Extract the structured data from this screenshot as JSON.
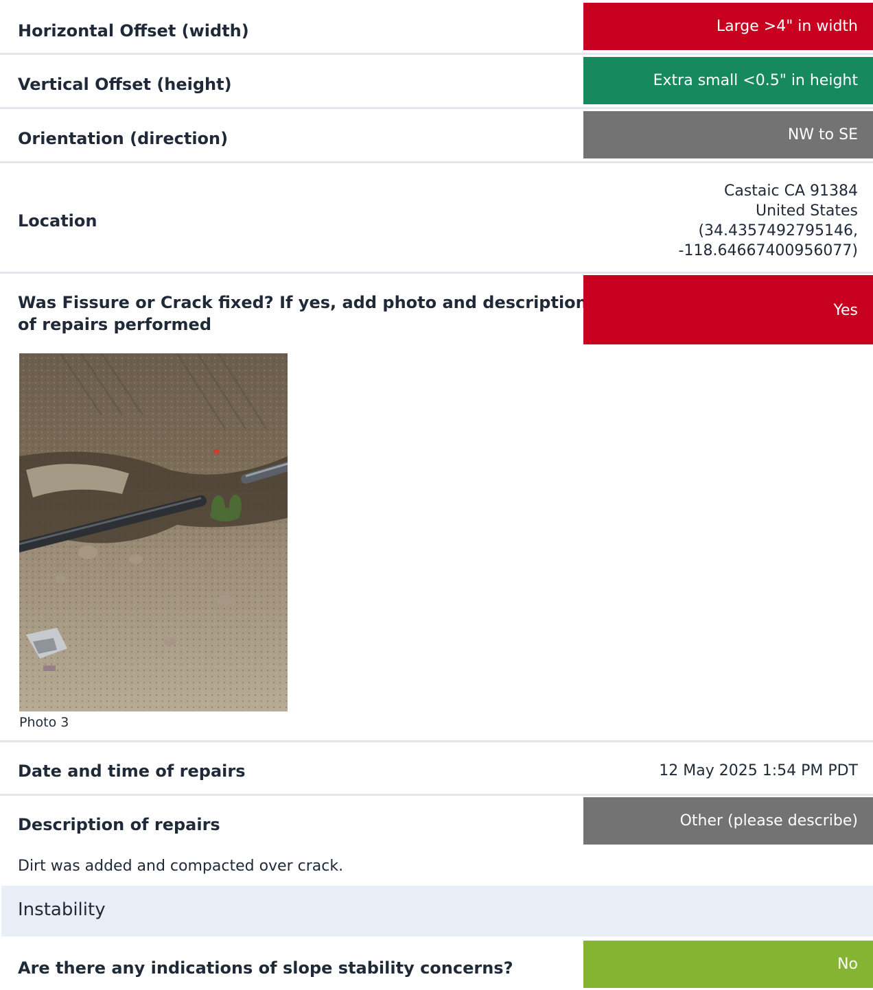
{
  "rows": {
    "horizontal_offset": {
      "label": "Horizontal Offset (width)",
      "value": "Large >4\" in width",
      "color": "#c8001f"
    },
    "vertical_offset": {
      "label": "Vertical Offset (height)",
      "value": "Extra small <0.5\" in height",
      "color": "#168a5e"
    },
    "orientation": {
      "label": "Orientation (direction)",
      "value": "NW to SE",
      "color": "#737373"
    },
    "location": {
      "label": "Location",
      "lines": [
        "Castaic CA 91384",
        "United States",
        "(34.4357492795146,",
        "-118.64667400956077)"
      ]
    },
    "fixed": {
      "label_line1": "Was Fissure or Crack fixed? If yes, add photo and description",
      "label_line2": "of repairs performed",
      "value": "Yes",
      "color": "#c8001f"
    },
    "photo": {
      "caption": "Photo 3"
    },
    "repair_date": {
      "label": "Date and time of repairs",
      "value": "12 May 2025 1:54 PM PDT"
    },
    "repair_description": {
      "label": "Description of repairs",
      "value": "Other (please describe)",
      "color": "#737373",
      "note": "Dirt was added and compacted over crack."
    }
  },
  "section": {
    "title": "Instability"
  },
  "slope": {
    "label": "Are there any indications of slope stability concerns?",
    "value": "No",
    "color": "#84b432"
  }
}
